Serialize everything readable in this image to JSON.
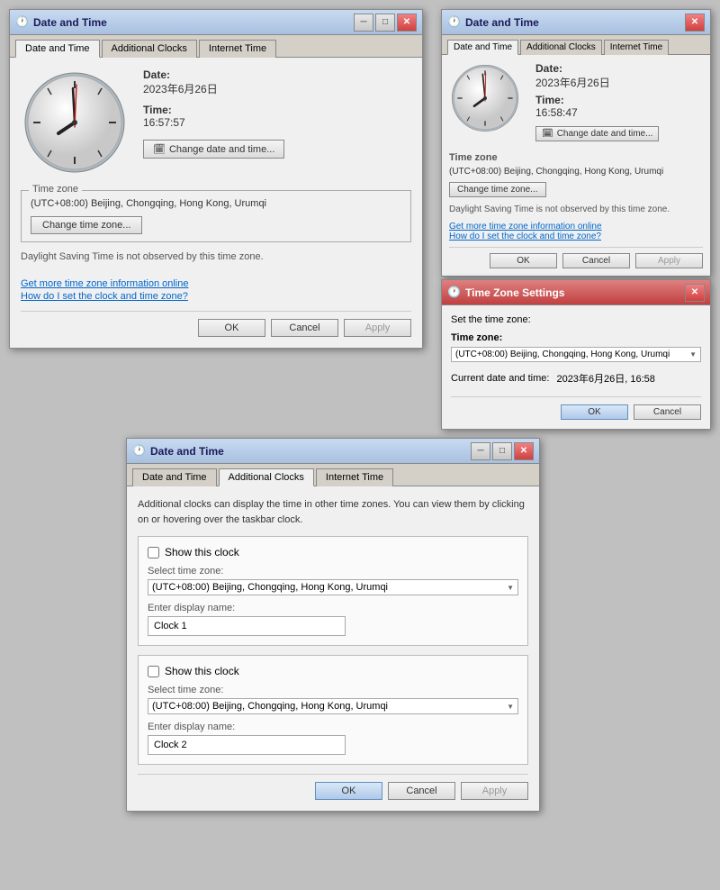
{
  "window1": {
    "title": "Date and Time",
    "tabs": [
      "Date and Time",
      "Additional Clocks",
      "Internet Time"
    ],
    "active_tab": "Date and Time",
    "date_label": "Date:",
    "date_value": "2023年6月26日",
    "time_label": "Time:",
    "time_value": "16:57:57",
    "change_datetime_btn": "Change date and time...",
    "timezone_group_label": "Time zone",
    "timezone_value": "(UTC+08:00) Beijing, Chongqing, Hong Kong, Urumqi",
    "change_timezone_btn": "Change time zone...",
    "dst_text": "Daylight Saving Time is not observed by this time zone.",
    "link1": "Get more time zone information online",
    "link2": "How do I set the clock and time zone?",
    "ok_btn": "OK",
    "cancel_btn": "Cancel",
    "apply_btn": "Apply"
  },
  "window2": {
    "title": "Date and Time",
    "tabs": [
      "Date and Time",
      "Additional Clocks",
      "Internet Time"
    ],
    "active_tab": "Date and Time",
    "date_label": "Date:",
    "date_value": "2023年6月26日",
    "time_label": "Time:",
    "time_value": "16:58:47",
    "change_datetime_btn": "Change date and time...",
    "timezone_label": "Time zone",
    "timezone_value": "(UTC+08:00) Beijing, Chongqing, Hong Kong, Urumqi",
    "change_timezone_btn": "Change time zone...",
    "dst_text": "Daylight Saving Time is not observed by this time zone.",
    "link1": "Get more time zone information online",
    "link2": "How do I set the clock and time zone?",
    "ok_btn": "OK",
    "cancel_btn": "Cancel",
    "apply_btn": "Apply"
  },
  "window3": {
    "title": "Time Zone Settings",
    "set_timezone_label": "Set the time zone:",
    "timezone_label": "Time zone:",
    "timezone_value": "(UTC+08:00) Beijing, Chongqing, Hong Kong, Urumqi",
    "current_dt_label": "Current date and time:",
    "current_dt_value": "2023年6月26日, 16:58",
    "ok_btn": "OK",
    "cancel_btn": "Cancel"
  },
  "window4": {
    "title": "Date and Time",
    "tabs": [
      "Date and Time",
      "Additional Clocks",
      "Internet Time"
    ],
    "active_tab": "Additional Clocks",
    "description": "Additional clocks can display the time in other time zones. You can view them by clicking on or hovering over the taskbar clock.",
    "clock1": {
      "show_label": "Show this clock",
      "tz_label": "Select time zone:",
      "tz_value": "(UTC+08:00) Beijing, Chongqing, Hong Kong, Urumqi",
      "name_label": "Enter display name:",
      "name_value": "Clock 1"
    },
    "clock2": {
      "show_label": "Show this clock",
      "tz_label": "Select time zone:",
      "tz_value": "(UTC+08:00) Beijing, Chongqing, Hong Kong, Urumqi",
      "name_label": "Enter display name:",
      "name_value": "Clock 2"
    },
    "ok_btn": "OK",
    "cancel_btn": "Cancel",
    "apply_btn": "Apply"
  }
}
